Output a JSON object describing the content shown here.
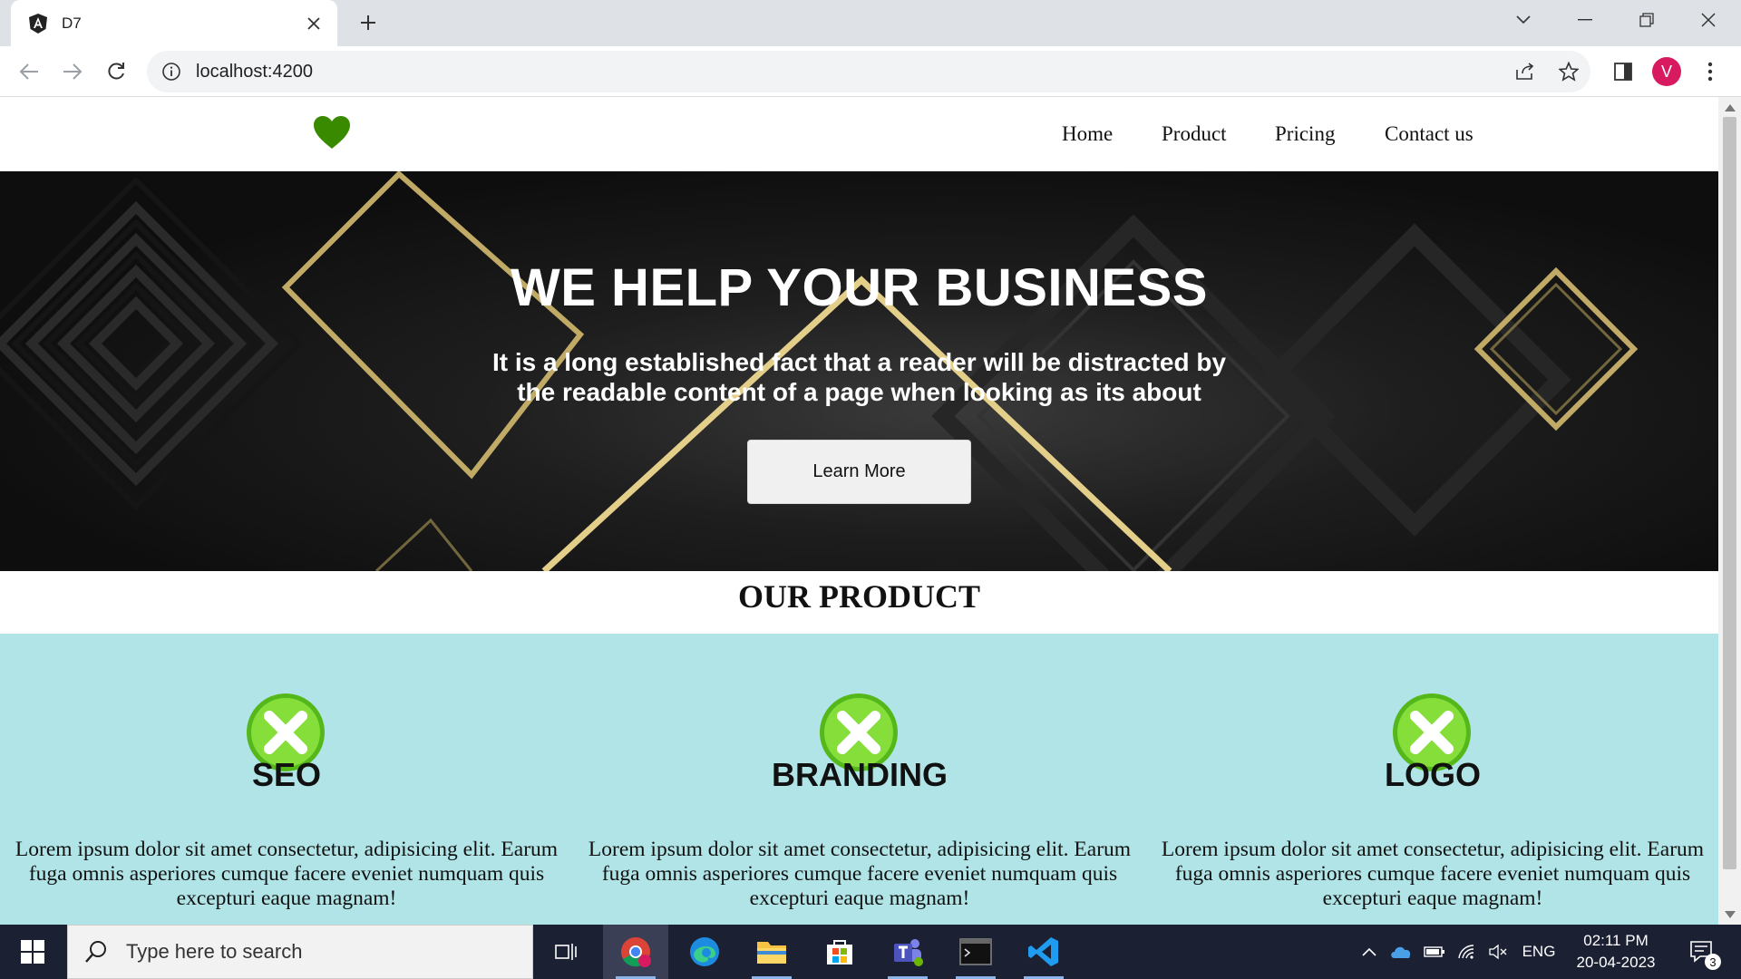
{
  "browser": {
    "tab_title": "D7",
    "url": "localhost:4200",
    "profile_initial": "V"
  },
  "site": {
    "nav": [
      "Home",
      "Product",
      "Pricing",
      "Contact us"
    ],
    "colors": {
      "logo": "#3a8a00",
      "products_bg": "#b0e4e6",
      "icon_green": "#7ed321"
    }
  },
  "hero": {
    "title": "WE HELP YOUR BUSINESS",
    "text": "It is a long established fact that a reader will be distracted by the readable content of a page when looking as its about",
    "button": "Learn More"
  },
  "products": {
    "section_title": "OUR PRODUCT",
    "items": [
      {
        "title": "SEO",
        "icon": "green-x-circle-icon",
        "text": "Lorem ipsum dolor sit amet consectetur, adipisicing elit. Earum fuga omnis asperiores cumque facere eveniet numquam quis excepturi eaque magnam!"
      },
      {
        "title": "BRANDING",
        "icon": "green-x-circle-icon",
        "text": "Lorem ipsum dolor sit amet consectetur, adipisicing elit. Earum fuga omnis asperiores cumque facere eveniet numquam quis excepturi eaque magnam!"
      },
      {
        "title": "LOGO",
        "icon": "green-x-circle-icon",
        "text": "Lorem ipsum dolor sit amet consectetur, adipisicing elit. Earum fuga omnis asperiores cumque facere eveniet numquam quis excepturi eaque magnam!"
      }
    ]
  },
  "taskbar": {
    "search_placeholder": "Type here to search",
    "language": "ENG",
    "time": "02:11 PM",
    "date": "20-04-2023",
    "notification_count": "3"
  }
}
